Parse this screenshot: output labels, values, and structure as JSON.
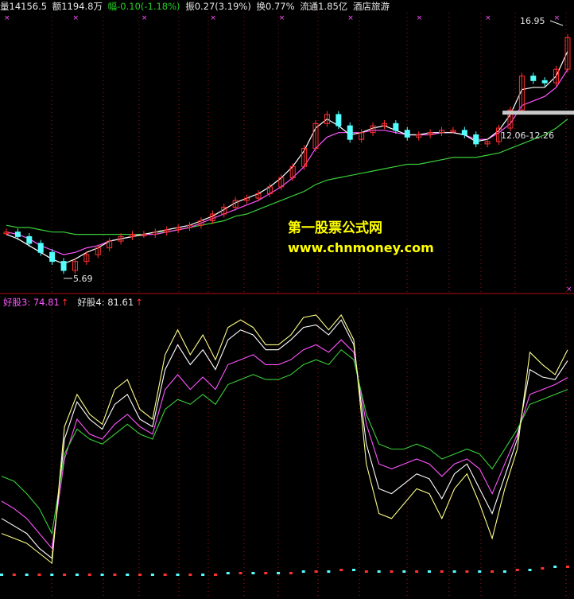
{
  "header": {
    "volume": "量14156.5",
    "amount": "额1194.8万",
    "change": "幅-0.10(-1.18%)",
    "amplitude": "振0.27(3.19%)",
    "turnover": "换0.77%",
    "float_cap": "流通1.85亿",
    "sector": "酒店旅游"
  },
  "price_labels": {
    "high": "16.95",
    "low": "5.69",
    "mid": "12.06-12.26"
  },
  "indicator_legend": {
    "item1": "好股3: 74.81",
    "item2": "好股4: 81.61"
  },
  "watermark": {
    "title": "第一股票公式网",
    "url": "www.chnmoney.com"
  },
  "colors": {
    "background": "#000000",
    "bull_candle": "#ff3232",
    "bear_candle": "#54ffff",
    "ma_white": "#ffffff",
    "ma_magenta": "#ff55ff",
    "ma_green": "#3ad03a",
    "indicator_yellow": "#ffff8a",
    "grid_red": "#b01010"
  },
  "chart_data": [
    {
      "type": "candlestick",
      "title": "",
      "annotations": [
        "16.95",
        "5.69",
        "12.06-12.26"
      ],
      "low_price": 5.69,
      "high_price": 16.95,
      "closes": [
        7.6,
        7.4,
        7.1,
        6.7,
        6.3,
        5.9,
        6.3,
        6.6,
        6.9,
        7.2,
        7.4,
        7.5,
        7.5,
        7.6,
        7.7,
        7.8,
        7.9,
        8.1,
        8.4,
        8.7,
        9.0,
        9.1,
        9.3,
        9.6,
        10.0,
        10.5,
        11.3,
        12.4,
        12.8,
        12.3,
        11.7,
        12.0,
        12.3,
        12.4,
        12.1,
        11.8,
        11.9,
        12.0,
        12.1,
        12.1,
        11.9,
        11.5,
        11.6,
        12.2,
        13.0,
        14.5,
        14.3,
        14.2,
        14.8,
        16.2
      ],
      "ma_white": [
        7.5,
        7.3,
        7.0,
        6.7,
        6.4,
        6.2,
        6.4,
        6.7,
        6.9,
        7.2,
        7.3,
        7.4,
        7.5,
        7.6,
        7.7,
        7.8,
        7.9,
        8.1,
        8.3,
        8.6,
        8.9,
        9.1,
        9.3,
        9.6,
        10.0,
        10.5,
        11.2,
        12.2,
        12.6,
        12.3,
        11.9,
        12.0,
        12.2,
        12.3,
        12.1,
        11.9,
        11.9,
        12.0,
        12.0,
        12.0,
        11.9,
        11.6,
        11.7,
        12.1,
        12.8,
        13.9,
        14.0,
        14.0,
        14.5,
        15.6
      ],
      "ma_magenta": [
        7.6,
        7.5,
        7.3,
        7.0,
        6.8,
        6.6,
        6.7,
        6.9,
        7.0,
        7.2,
        7.3,
        7.4,
        7.5,
        7.5,
        7.6,
        7.7,
        7.8,
        8.0,
        8.2,
        8.4,
        8.6,
        8.8,
        9.0,
        9.3,
        9.6,
        10.0,
        10.5,
        11.3,
        11.8,
        12.0,
        12.0,
        12.0,
        12.1,
        12.1,
        12.0,
        11.9,
        11.9,
        11.9,
        12.0,
        12.0,
        11.9,
        11.7,
        11.7,
        12.0,
        12.4,
        13.2,
        13.4,
        13.6,
        14.0,
        14.8
      ],
      "ma_green": [
        7.9,
        7.8,
        7.8,
        7.7,
        7.6,
        7.6,
        7.5,
        7.5,
        7.5,
        7.5,
        7.5,
        7.5,
        7.5,
        7.6,
        7.6,
        7.7,
        7.8,
        7.9,
        8.0,
        8.1,
        8.3,
        8.4,
        8.6,
        8.8,
        9.0,
        9.2,
        9.4,
        9.7,
        9.9,
        10.0,
        10.1,
        10.2,
        10.3,
        10.4,
        10.5,
        10.6,
        10.6,
        10.7,
        10.8,
        10.9,
        10.9,
        10.9,
        11.0,
        11.1,
        11.3,
        11.5,
        11.7,
        11.9,
        12.2,
        12.6
      ]
    },
    {
      "type": "line",
      "title": "",
      "series": [
        {
          "name": "好股3",
          "color": "#ff55ff",
          "values": [
            25,
            22,
            18,
            12,
            6,
            42,
            58,
            52,
            50,
            56,
            60,
            55,
            52,
            70,
            76,
            70,
            75,
            70,
            80,
            82,
            84,
            80,
            80,
            82,
            86,
            88,
            85,
            90,
            85,
            56,
            40,
            38,
            40,
            42,
            40,
            35,
            40,
            42,
            38,
            28,
            40,
            52,
            68,
            70,
            72,
            74.81
          ]
        },
        {
          "name": "好股4",
          "color": "#ffffff",
          "values": [
            18,
            15,
            12,
            6,
            2,
            50,
            65,
            58,
            54,
            64,
            68,
            58,
            55,
            78,
            88,
            80,
            86,
            78,
            90,
            94,
            92,
            86,
            86,
            90,
            95,
            96,
            92,
            98,
            88,
            48,
            30,
            28,
            32,
            36,
            34,
            26,
            36,
            40,
            30,
            20,
            35,
            50,
            78,
            75,
            74,
            81.61
          ]
        },
        {
          "name": "",
          "color": "#3ad03a",
          "values": [
            35,
            33,
            28,
            22,
            12,
            44,
            54,
            50,
            48,
            52,
            56,
            52,
            50,
            62,
            66,
            64,
            68,
            64,
            72,
            74,
            76,
            74,
            74,
            76,
            80,
            82,
            80,
            86,
            82,
            60,
            48,
            46,
            46,
            48,
            46,
            42,
            44,
            46,
            44,
            38,
            46,
            54,
            64,
            66,
            68,
            70
          ]
        },
        {
          "name": "",
          "color": "#ffff8a",
          "values": [
            12,
            10,
            8,
            4,
            0,
            55,
            68,
            60,
            56,
            70,
            74,
            62,
            58,
            84,
            94,
            84,
            92,
            82,
            95,
            98,
            95,
            88,
            88,
            92,
            99,
            100,
            94,
            100,
            90,
            40,
            20,
            18,
            24,
            30,
            28,
            18,
            30,
            36,
            24,
            10,
            30,
            46,
            85,
            80,
            76,
            86
          ]
        }
      ],
      "volume_bars": [
        1,
        1,
        1,
        1,
        1,
        1,
        1,
        1,
        1,
        1,
        1,
        1,
        1,
        1,
        1,
        1,
        1,
        1,
        2,
        2,
        2,
        2,
        2,
        2,
        3,
        3,
        3,
        4,
        4,
        3,
        3,
        3,
        3,
        3,
        3,
        3,
        3,
        3,
        3,
        3,
        3,
        4,
        4,
        5,
        6,
        6
      ]
    }
  ]
}
